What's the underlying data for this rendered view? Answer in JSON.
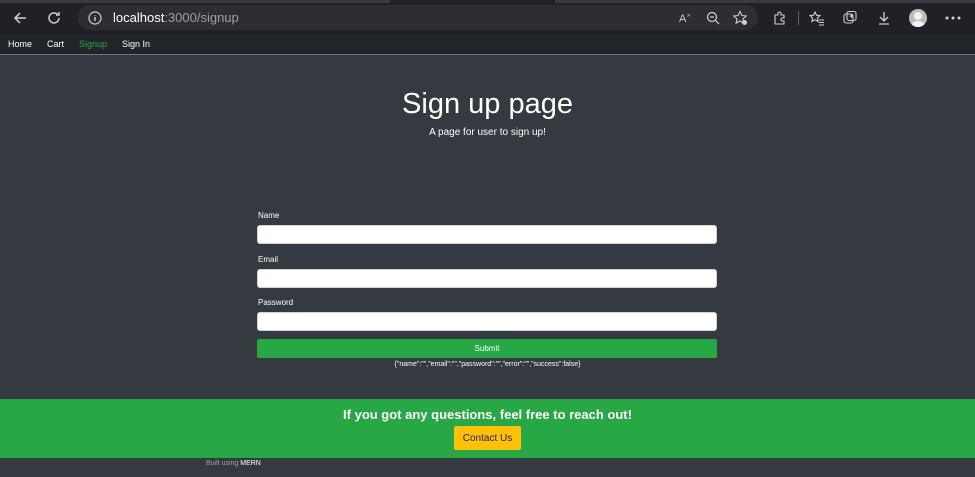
{
  "browser": {
    "url_host": "localhost",
    "url_path": ":3000/signup",
    "icons": [
      "back-icon",
      "reload-icon",
      "info-icon",
      "read-aloud-icon",
      "zoom-icon",
      "add-favorite-icon",
      "extensions-icon",
      "favorites-icon",
      "collections-icon",
      "downloads-icon",
      "profile-avatar",
      "more-icon"
    ]
  },
  "nav": {
    "home": "Home",
    "cart": "Cart",
    "signup": "Signup",
    "signin": "Sign In"
  },
  "hero": {
    "title": "Sign up page",
    "subtitle": "A page for user to sign up!"
  },
  "form": {
    "name_label": "Name",
    "name_value": "",
    "email_label": "Email",
    "email_value": "",
    "password_label": "Password",
    "password_value": "",
    "submit_label": "Submit",
    "state_dump": "{\"name\":\"\",\"email\":\"\",\"password\":\"\",\"error\":\"\",\"success\":false}"
  },
  "cta": {
    "heading": "If you got any questions, feel free to reach out!",
    "button": "Contact Us"
  },
  "footer": {
    "prefix": "Built using",
    "stack": "MERN"
  },
  "colors": {
    "page_bg": "#343a40",
    "navbar_bg": "#212529",
    "accent_green": "#28a745",
    "warning_yellow": "#ffc107"
  }
}
